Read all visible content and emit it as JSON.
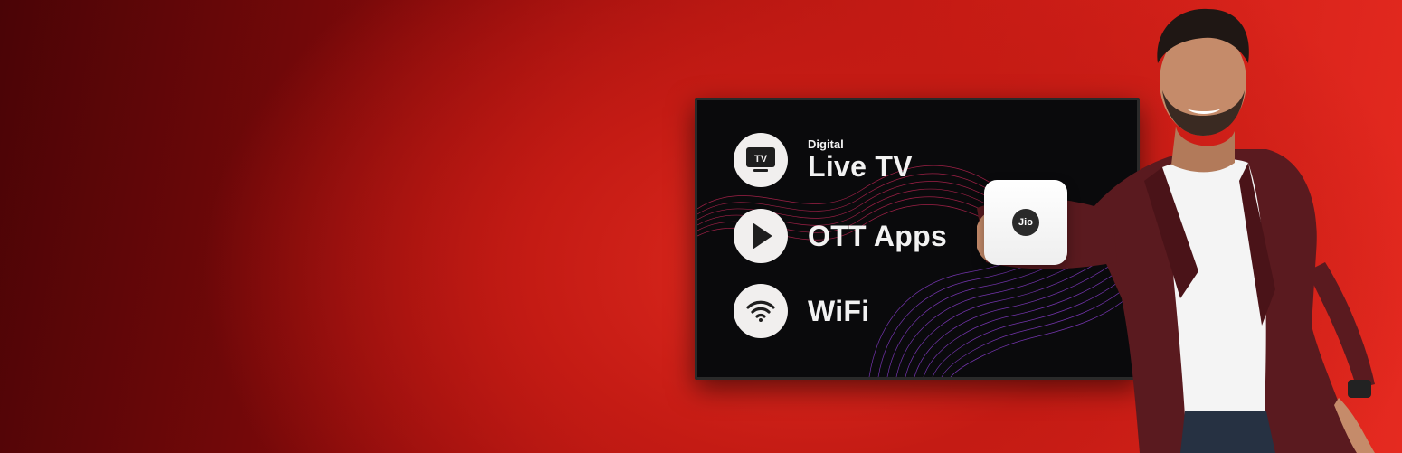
{
  "tv_screen": {
    "features": [
      {
        "sub_label": "Digital",
        "label": "Live TV",
        "icon": "tv-icon"
      },
      {
        "sub_label": "",
        "label": "OTT Apps",
        "icon": "play-icon"
      },
      {
        "sub_label": "",
        "label": "WiFi",
        "icon": "wifi-icon"
      }
    ],
    "tv_icon_text": "TV"
  },
  "device": {
    "logo_text": "Jio"
  },
  "colors": {
    "background_dark": "#4a0406",
    "background_bright": "#e52a20",
    "screen": "#0a0a0c",
    "icon_circle": "#f1efee",
    "jacket": "#5a1a1f"
  }
}
